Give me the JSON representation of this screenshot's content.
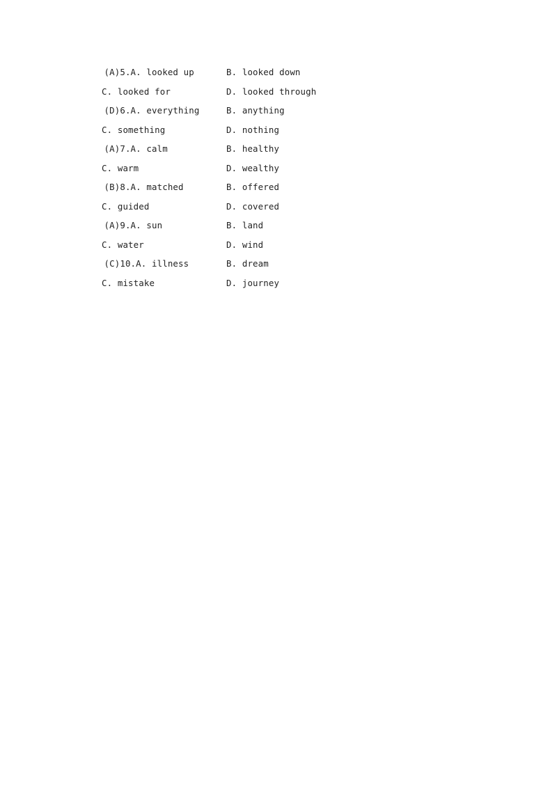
{
  "document": {
    "type": "scanned-exam-page",
    "background_color": "#ffffff",
    "text_color": "#232323",
    "questions": [
      {
        "answer_key": "(A)",
        "number": "5.",
        "option_a": "A. looked up",
        "option_b": "B. looked down",
        "option_c": "C. looked for",
        "option_d": "D. looked through"
      },
      {
        "answer_key": "(D)",
        "number": "6.",
        "option_a": "A. everything",
        "option_b": "B. anything",
        "option_c": "C. something",
        "option_d": "D. nothing"
      },
      {
        "answer_key": "(A)",
        "number": "7.",
        "option_a": "A. calm",
        "option_b": "B. healthy",
        "option_c": "C. warm",
        "option_d": "D. wealthy"
      },
      {
        "answer_key": "(B)",
        "number": "8.",
        "option_a": "A. matched",
        "option_b": "B. offered",
        "option_c": "C. guided",
        "option_d": "D. covered"
      },
      {
        "answer_key": "(A)",
        "number": "9.",
        "option_a": "A. sun",
        "option_b": "B. land",
        "option_c": "C. water",
        "option_d": "D. wind"
      },
      {
        "answer_key": "(C)",
        "number": "10.",
        "option_a": "A. illness",
        "option_b": "B. dream",
        "option_c": "C. mistake",
        "option_d": "D. journey"
      }
    ]
  }
}
